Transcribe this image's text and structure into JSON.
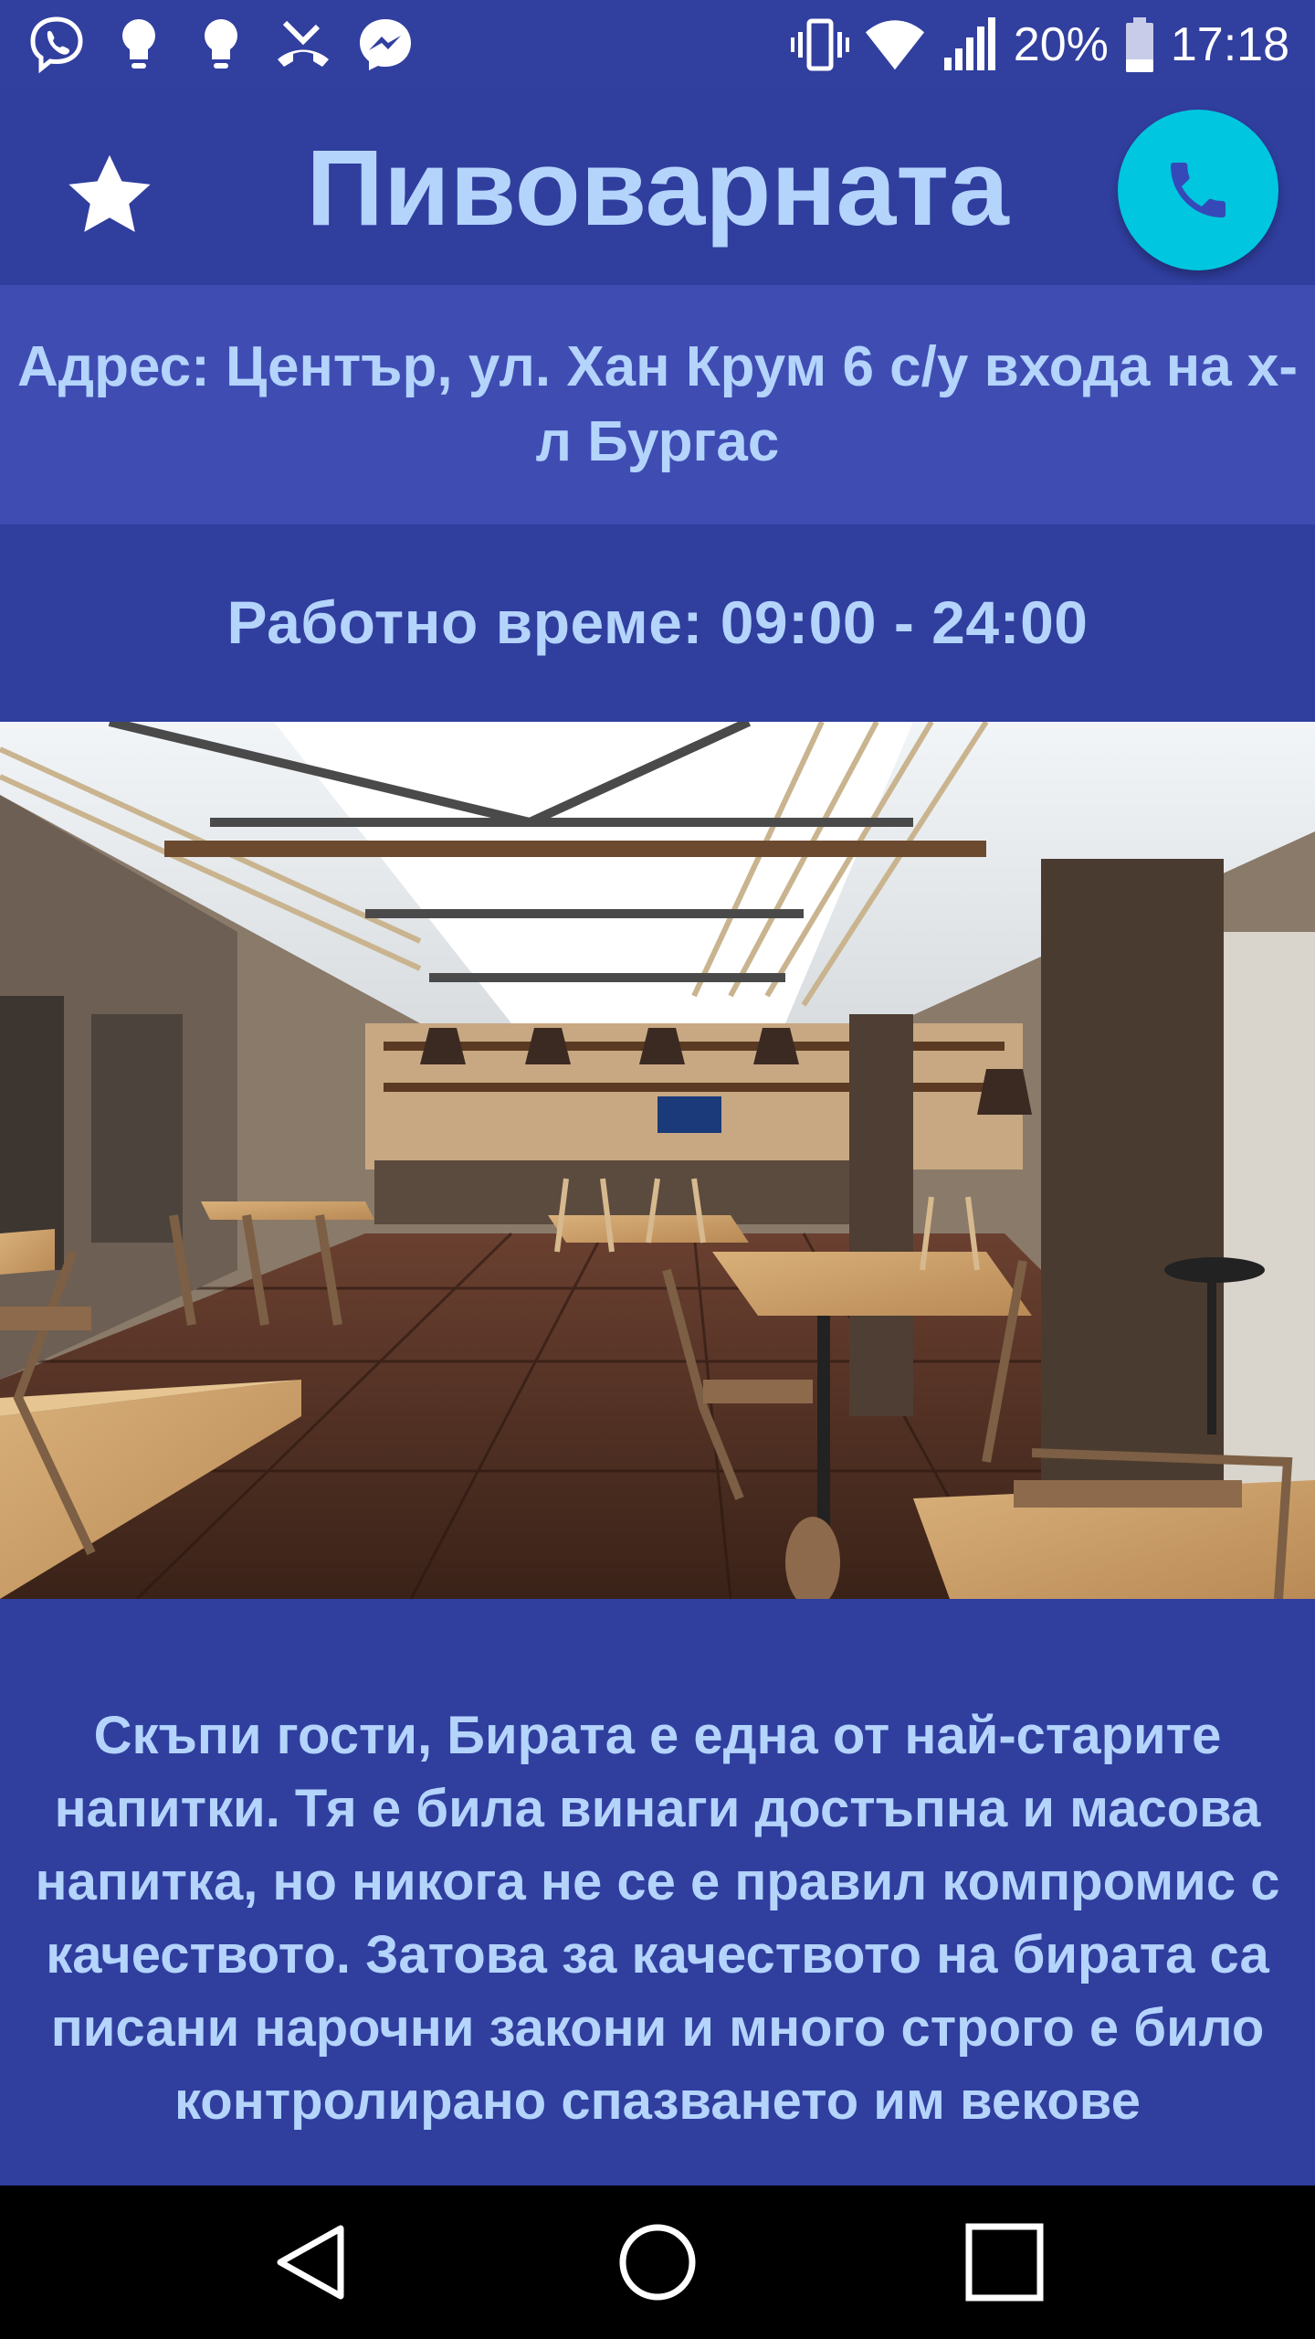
{
  "status_bar": {
    "left_icons": [
      "viber-icon",
      "lightbulb-icon",
      "lightbulb-icon",
      "missed-call-icon",
      "messenger-icon"
    ],
    "right_icons": [
      "vibrate-icon",
      "wifi-icon",
      "signal-icon",
      "battery-icon"
    ],
    "battery_percent": "20%",
    "time": "17:18"
  },
  "app_bar": {
    "title": "Пивоварната",
    "favorite_icon": "star-icon",
    "call_icon": "phone-icon",
    "call_button_color": "#00c6df"
  },
  "address": "Адрес: Център, ул. Хан Крум 6 с/у входа на х-л Бургас",
  "hours": "Работно време: 09:00 - 24:00",
  "photo": {
    "subject": "restaurant interior photo"
  },
  "description": "Скъпи гости, Бирата е една от най-старите напитки. Тя е била винаги достъпна и масова напитка, но никога не се е правил компромис с качеството. Затова за качеството на бирата са писани нарочни закони и много строго е било контролирано спазването им векове",
  "nav_bar": {
    "back_icon": "back-triangle-icon",
    "home_icon": "home-circle-icon",
    "recents_icon": "recents-square-icon"
  },
  "colors": {
    "background": "#303e9e",
    "address_band": "#3f4db3",
    "text": "#b4d4fb"
  }
}
